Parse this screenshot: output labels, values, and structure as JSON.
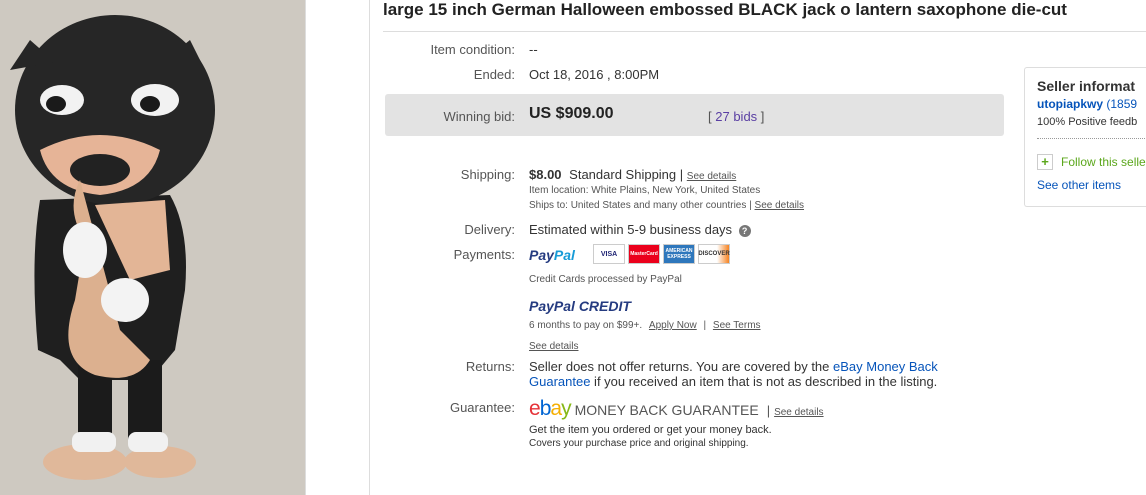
{
  "title": "large 15 inch German Halloween embossed BLACK jack o lantern saxophone die-cut",
  "condition": {
    "label": "Item condition:",
    "value": "--"
  },
  "ended": {
    "label": "Ended:",
    "value": "Oct 18, 2016 , 8:00PM"
  },
  "winning_bid": {
    "label": "Winning bid:",
    "value": "US $909.00",
    "bids": "27 bids",
    "bracket_open": "[",
    "bracket_close": "]"
  },
  "shipping": {
    "label": "Shipping:",
    "cost": "$8.00",
    "method": "Standard Shipping",
    "pipe": "|",
    "see_details": "See details",
    "location_label": "Item location:",
    "location": "White Plains, New York, United States",
    "ships_label": "Ships to:",
    "ships_to": "United States and many other countries",
    "ships_see_details": "See details"
  },
  "delivery": {
    "label": "Delivery:",
    "value": "Estimated within 5-9 business days",
    "help_icon": "?"
  },
  "payments": {
    "label": "Payments:",
    "paypal_pay": "Pay",
    "paypal_pal": "Pal",
    "cards": [
      "VISA",
      "MasterCard",
      "AMERICAN EXPRESS",
      "DISCOVER"
    ],
    "cards_note": "Credit Cards processed by PayPal",
    "credit_logo": "PayPal CREDIT",
    "credit_text": "6 months to pay on $99+.",
    "apply_now": "Apply Now",
    "see_terms": "See Terms",
    "see_details": "See details"
  },
  "returns": {
    "label": "Returns:",
    "text1": "Seller does not offer returns. You are covered by the ",
    "link1": "eBay Money Back",
    "link2": "Guarantee",
    "text2": " if you received an item that is not as described in the listing."
  },
  "guarantee": {
    "label": "Guarantee:",
    "logo_letters": [
      "e",
      "b",
      "a",
      "y"
    ],
    "logo_text": "MONEY BACK GUARANTEE",
    "see_details": "See details",
    "line1": "Get the item you ordered or get your money back.",
    "line2": "Covers your purchase price and original shipping."
  },
  "seller": {
    "heading": "Seller informat",
    "username": "utopiapkwy",
    "score": "(1859",
    "feedback": "100% Positive feedb",
    "follow": "Follow this selle",
    "see_other": "See other items"
  },
  "colors": {
    "link": "#0654ba",
    "ebay_e": "#e53238",
    "ebay_b": "#0064d2",
    "ebay_a": "#f5af02",
    "ebay_y": "#86b817"
  }
}
